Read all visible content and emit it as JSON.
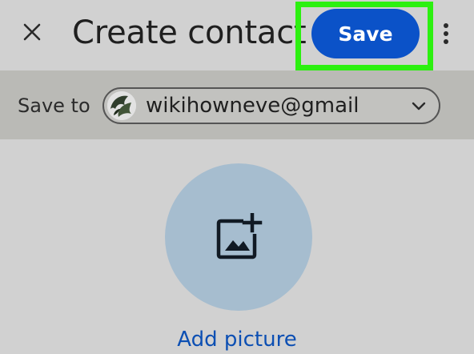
{
  "header": {
    "title": "Create contact",
    "save_label": "Save",
    "close_icon": "close-icon",
    "more_icon": "more-vert-icon"
  },
  "account": {
    "label": "Save to",
    "email": "wikihowneve@gmail",
    "avatar_icon": "avatar",
    "dropdown_icon": "chevron-down-icon"
  },
  "photo": {
    "add_label": "Add picture",
    "icon": "add-photo-icon"
  },
  "colors": {
    "background": "#d1d1d1",
    "band": "#babab6",
    "save_button": "#0b52c8",
    "highlight": "#2cf010",
    "photo_circle": "#a6bdcf",
    "link": "#0c4fb3"
  }
}
